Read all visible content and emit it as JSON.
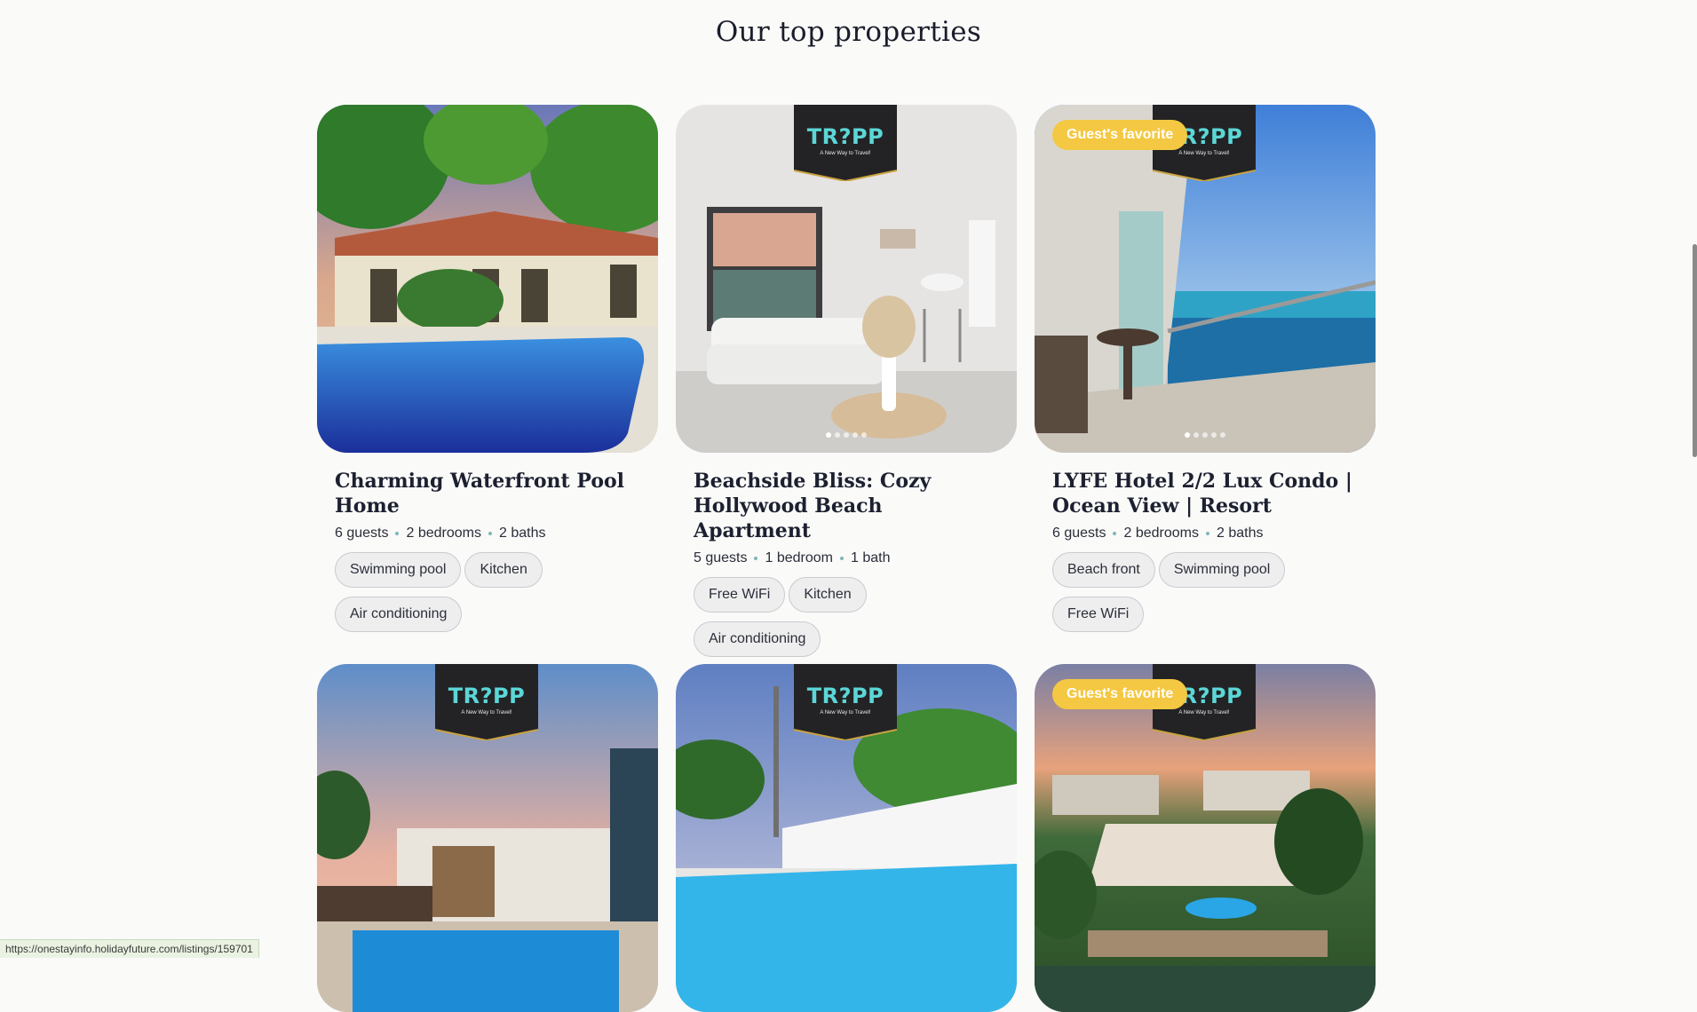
{
  "section": {
    "title": "Our top properties"
  },
  "logo": {
    "text": "TR?PP",
    "tagline": "A New Way to Travel!"
  },
  "cards": [
    {
      "title": "Charming Waterfront Pool Home",
      "guests": "6 guests",
      "bedrooms": "2 bedrooms",
      "baths": "2 baths",
      "tags": [
        "Swimming pool",
        "Kitchen",
        "Air conditioning"
      ],
      "badge": "",
      "has_logo": false,
      "dots": 0
    },
    {
      "title": "Beachside Bliss: Cozy Hollywood Beach Apartment",
      "guests": "5 guests",
      "bedrooms": "1 bedroom",
      "baths": "1 bath",
      "tags": [
        "Free WiFi",
        "Kitchen",
        "Air conditioning"
      ],
      "badge": "",
      "has_logo": true,
      "dots": 5
    },
    {
      "title": "LYFE Hotel 2/2 Lux Condo | Ocean View | Resort",
      "guests": "6 guests",
      "bedrooms": "2 bedrooms",
      "baths": "2 baths",
      "tags": [
        "Beach front",
        "Swimming pool",
        "Free WiFi"
      ],
      "badge": "Guest's favorite",
      "has_logo": true,
      "dots": 5
    },
    {
      "title": "",
      "badge": "",
      "has_logo": true
    },
    {
      "title": "",
      "badge": "",
      "has_logo": true
    },
    {
      "title": "",
      "badge": "Guest's favorite",
      "has_logo": true
    }
  ],
  "status_bar": {
    "url": "https://onestayinfo.holidayfuture.com/listings/159701"
  },
  "colors": {
    "badge": "#f4c842",
    "logo_teal": "#5cd6d6",
    "background": "#fafaf9"
  }
}
